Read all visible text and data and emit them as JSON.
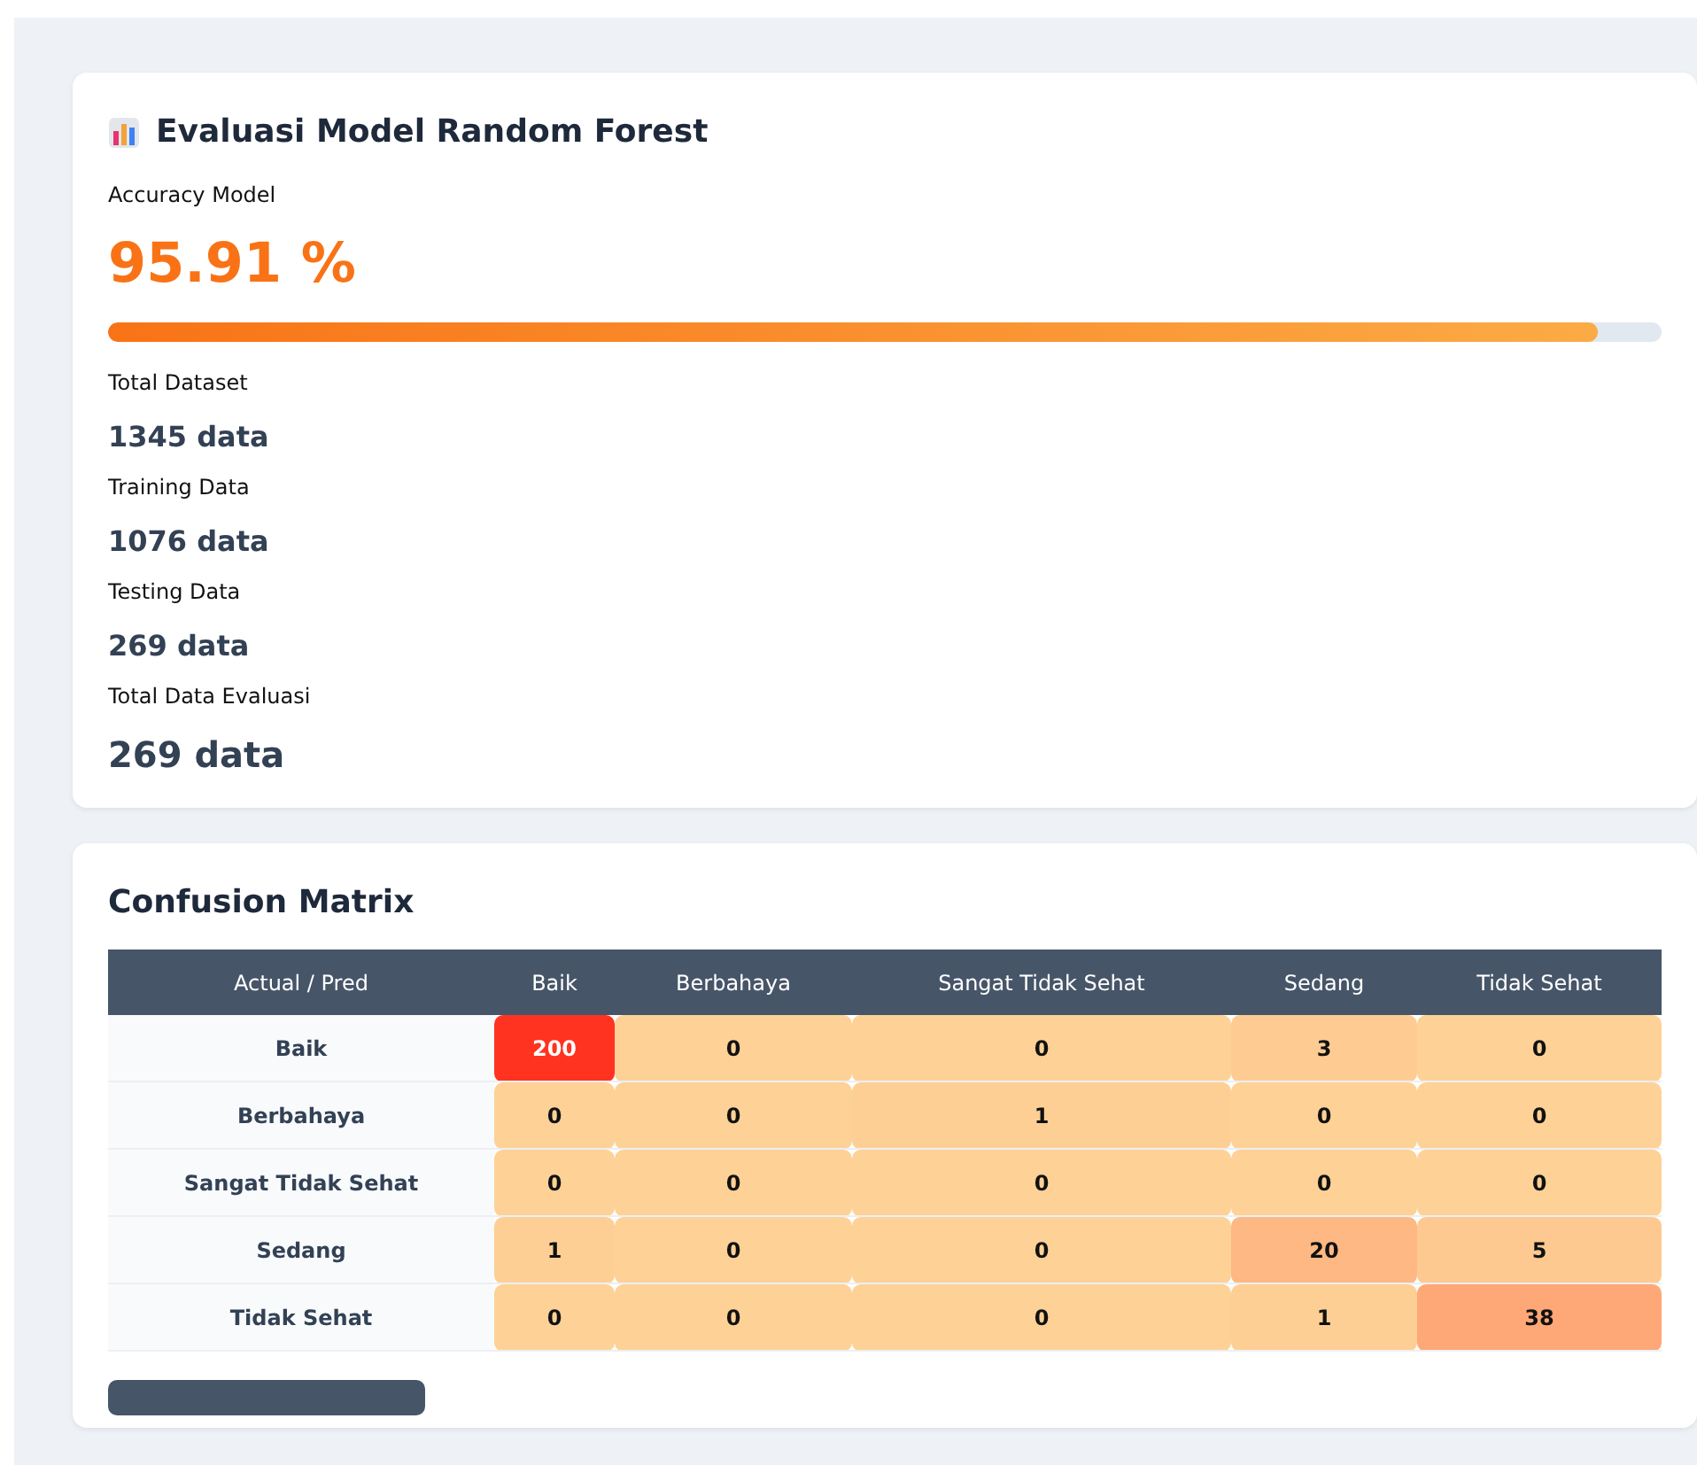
{
  "evaluation": {
    "title": "Evaluasi Model Random Forest",
    "accuracy_label": "Accuracy Model",
    "accuracy_value": "95.91 %",
    "accuracy_bar": {
      "level": 0.9591
    },
    "stats": [
      {
        "label": "Total Dataset",
        "value": "1345 data"
      },
      {
        "label": "Training Data",
        "value": "1076 data"
      },
      {
        "label": "Testing Data",
        "value": "269 data"
      },
      {
        "label": "Total Data Evaluasi",
        "value": "269 data",
        "emphasis": true
      }
    ]
  },
  "confusion_matrix": {
    "title": "Confusion Matrix",
    "columns": [
      "Actual / Pred",
      "Baik",
      "Berbahaya",
      "Sangat Tidak Sehat",
      "Sedang",
      "Tidak Sehat"
    ],
    "rows": [
      {
        "cells": [
          "Baik",
          "200",
          "0",
          "0",
          "3",
          "0"
        ]
      },
      {
        "cells": [
          "Berbahaya",
          "0",
          "0",
          "1",
          "0",
          "0"
        ]
      },
      {
        "cells": [
          "Sangat Tidak Sehat",
          "0",
          "0",
          "0",
          "0",
          "0"
        ]
      },
      {
        "cells": [
          "Sedang",
          "1",
          "0",
          "0",
          "20",
          "5"
        ]
      },
      {
        "cells": [
          "Tidak Sehat",
          "0",
          "0",
          "0",
          "1",
          "38"
        ]
      }
    ]
  }
}
